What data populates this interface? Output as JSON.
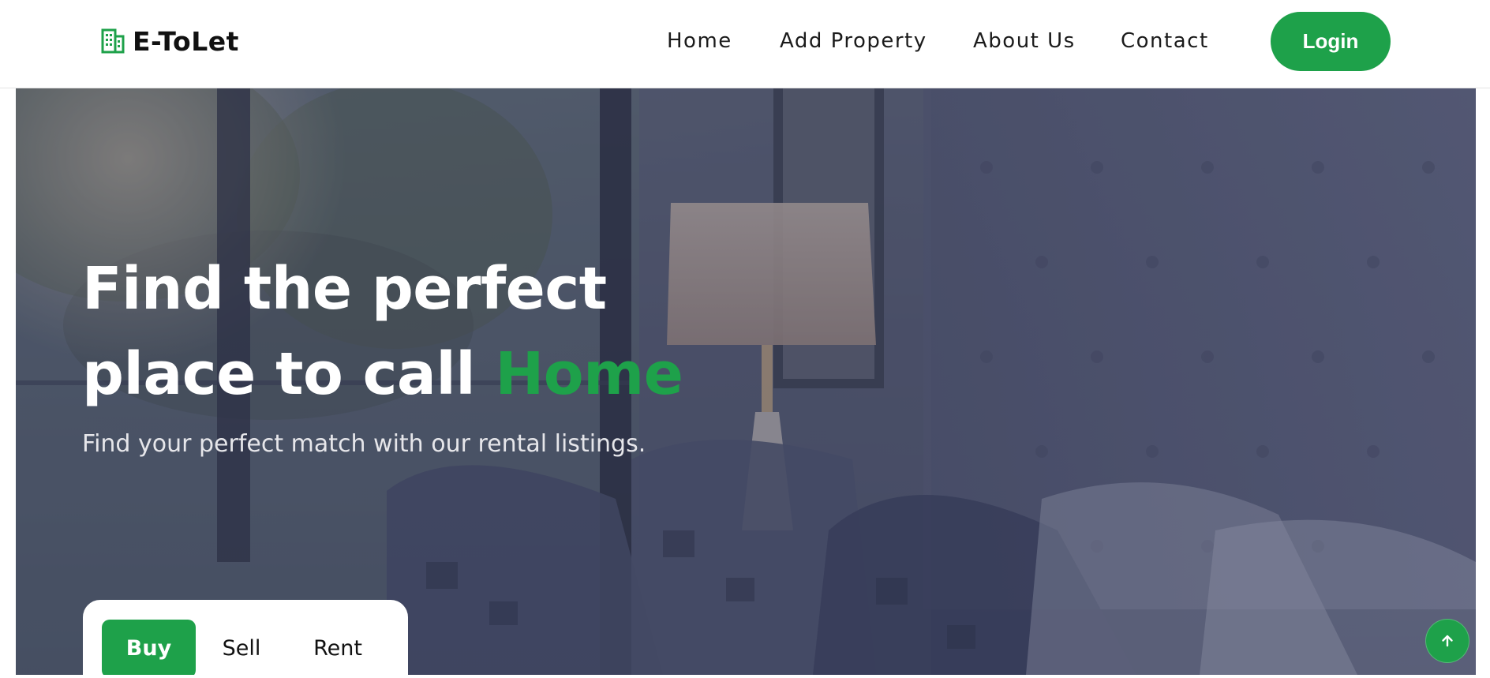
{
  "brand": {
    "name": "E-ToLet",
    "icon": "building-icon"
  },
  "nav": {
    "links": [
      "Home",
      "Add Property",
      "About Us",
      "Contact"
    ],
    "login_label": "Login"
  },
  "hero": {
    "title_line1": "Find the perfect",
    "title_line2_prefix": "place to call ",
    "title_accent": "Home",
    "subtitle": "Find your perfect match with our rental listings."
  },
  "search_tabs": {
    "items": [
      "Buy",
      "Sell",
      "Rent"
    ],
    "active": "Buy"
  },
  "scroll_top": {
    "icon": "arrow-up-icon"
  },
  "colors": {
    "accent": "#1ea14a",
    "nav_text": "#1b1b1b",
    "hero_overlay": "#3c4560"
  }
}
